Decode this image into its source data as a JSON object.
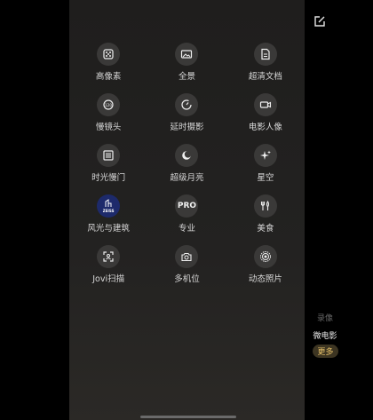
{
  "modes": [
    {
      "label": "高像素",
      "icon": "dice-icon"
    },
    {
      "label": "全景",
      "icon": "panorama-icon"
    },
    {
      "label": "超清文档",
      "icon": "document-icon"
    },
    {
      "label": "慢镜头",
      "icon": "slow-motion-icon"
    },
    {
      "label": "延时摄影",
      "icon": "timelapse-icon"
    },
    {
      "label": "电影人像",
      "icon": "movie-camera-icon"
    },
    {
      "label": "时光慢门",
      "icon": "long-exposure-icon"
    },
    {
      "label": "超级月亮",
      "icon": "moon-icon"
    },
    {
      "label": "星空",
      "icon": "sparkle-icon"
    },
    {
      "label": "风光与建筑",
      "icon": "zeiss-icon",
      "badge": "ZEISS"
    },
    {
      "label": "专业",
      "icon": "pro-icon",
      "badge": "PRO"
    },
    {
      "label": "美食",
      "icon": "cutlery-icon"
    },
    {
      "label": "Jovi扫描",
      "icon": "scan-icon"
    },
    {
      "label": "多机位",
      "icon": "multi-camera-icon"
    },
    {
      "label": "动态照片",
      "icon": "live-photo-icon"
    }
  ],
  "side": {
    "faded_label": "录像",
    "active_label": "微电影",
    "more_label": "更多"
  },
  "colors": {
    "background": "#000000",
    "panel": "#222120",
    "icon_bg": "#3a3938",
    "accent": "#e8c26a",
    "zeiss": "#1d2a6b"
  }
}
